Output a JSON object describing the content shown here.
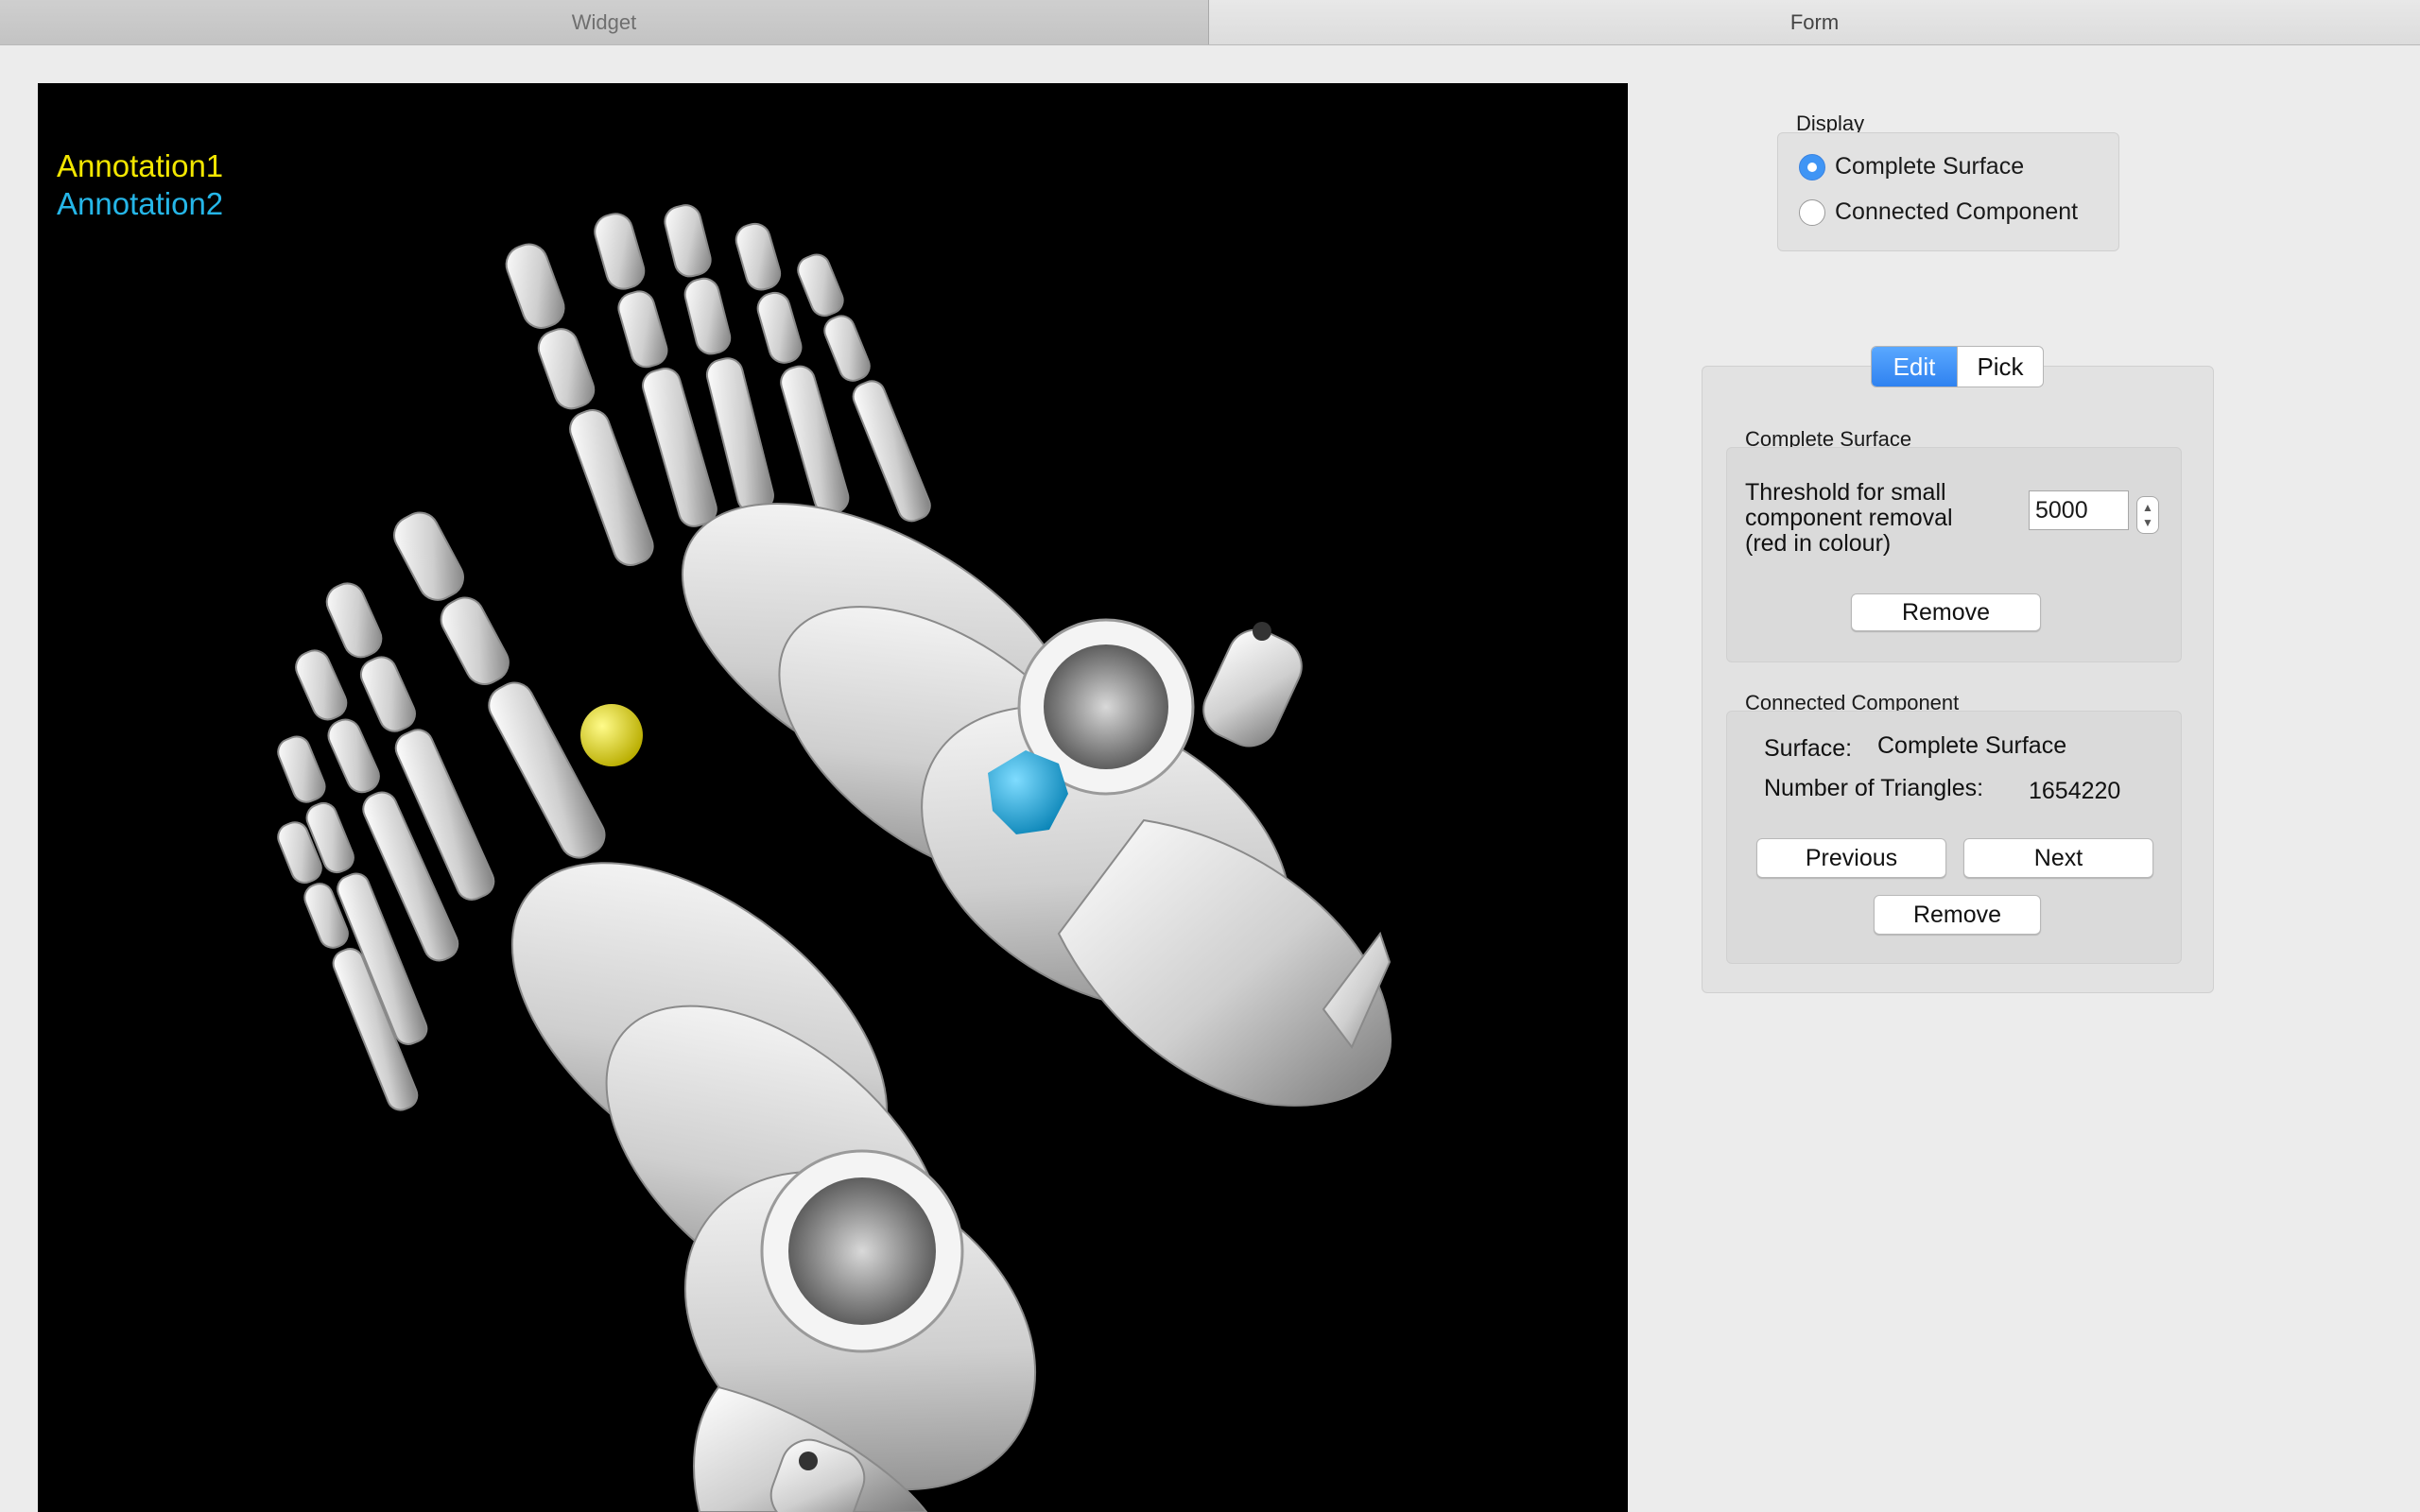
{
  "tabs": {
    "widget": "Widget",
    "form": "Form"
  },
  "viewport": {
    "annotations": [
      {
        "label": "Annotation1",
        "color": "#f2e600"
      },
      {
        "label": "Annotation2",
        "color": "#25b6e8"
      }
    ]
  },
  "display_group": {
    "title": "Display",
    "options": [
      {
        "label": "Complete Surface",
        "checked": true
      },
      {
        "label": "Connected Component",
        "checked": false
      }
    ]
  },
  "mode_tabs": {
    "edit": "Edit",
    "pick": "Pick",
    "selected": "Edit"
  },
  "complete_surface_group": {
    "title": "Complete Surface",
    "threshold_lines": [
      "Threshold for small",
      "component removal",
      "(red in colour)"
    ],
    "threshold_value": "5000",
    "remove_label": "Remove"
  },
  "connected_component_group": {
    "title": "Connected Component",
    "surface_label": "Surface:",
    "surface_value": "Complete Surface",
    "triangles_label": "Number of Triangles:",
    "triangles_value": "1654220",
    "previous_label": "Previous",
    "next_label": "Next",
    "remove_label": "Remove"
  },
  "icons": {
    "spinner": "stepper-icon",
    "radio": "radio-icon"
  }
}
